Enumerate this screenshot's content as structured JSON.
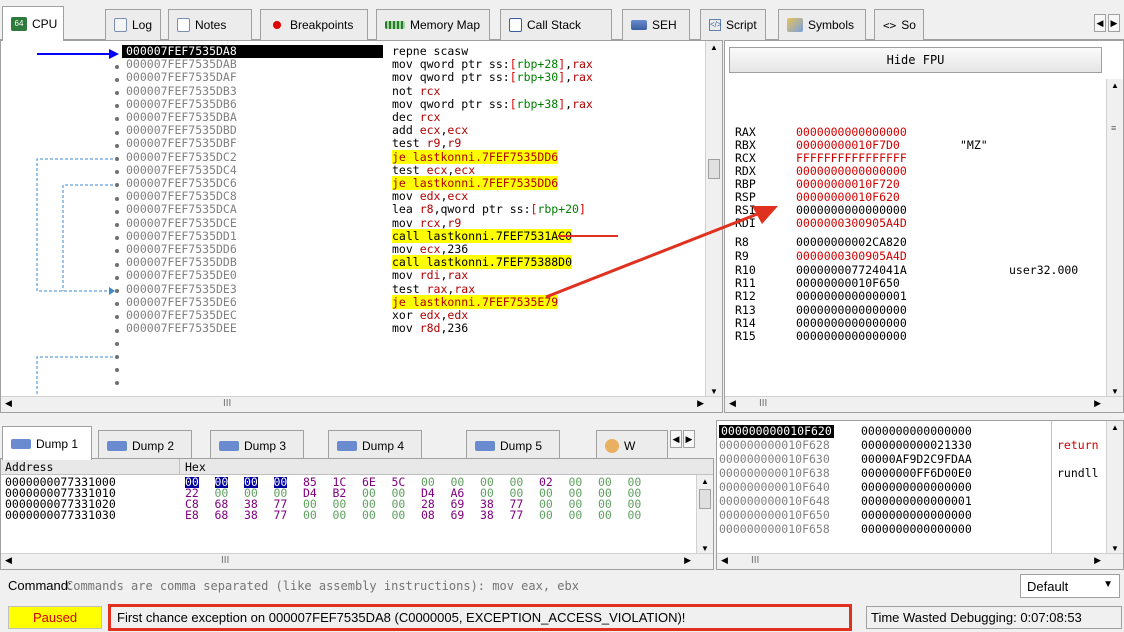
{
  "tabs": [
    {
      "label": "CPU",
      "icon": "cpu-icon"
    },
    {
      "label": "Log",
      "icon": "log-icon"
    },
    {
      "label": "Notes",
      "icon": "notes-icon"
    },
    {
      "label": "Breakpoints",
      "icon": "breakpoint-icon"
    },
    {
      "label": "Memory Map",
      "icon": "memory-map-icon"
    },
    {
      "label": "Call Stack",
      "icon": "call-stack-icon"
    },
    {
      "label": "SEH",
      "icon": "seh-icon"
    },
    {
      "label": "Script",
      "icon": "script-icon"
    },
    {
      "label": "Symbols",
      "icon": "symbols-icon"
    },
    {
      "label": "So",
      "icon": "source-icon"
    }
  ],
  "disasm": {
    "rip_label": "RIP",
    "rows": [
      {
        "addr": "000007FEF7535DA8",
        "ins": "repne scasw"
      },
      {
        "addr": "000007FEF7535DAB",
        "ins": "mov qword ptr ss:[rbp+28],rax"
      },
      {
        "addr": "000007FEF7535DAF",
        "ins": "mov qword ptr ss:[rbp+30],rax"
      },
      {
        "addr": "000007FEF7535DB3",
        "ins": "not rcx"
      },
      {
        "addr": "000007FEF7535DB6",
        "ins": "mov qword ptr ss:[rbp+38],rax"
      },
      {
        "addr": "000007FEF7535DBA",
        "ins": "dec rcx"
      },
      {
        "addr": "000007FEF7535DBD",
        "ins": "add ecx,ecx"
      },
      {
        "addr": "000007FEF7535DBF",
        "ins": "test r9,r9"
      },
      {
        "addr": "000007FEF7535DC2",
        "ins": "je lastkonni.7FEF7535DD6"
      },
      {
        "addr": "000007FEF7535DC4",
        "ins": "test ecx,ecx"
      },
      {
        "addr": "000007FEF7535DC6",
        "ins": "je lastkonni.7FEF7535DD6"
      },
      {
        "addr": "000007FEF7535DC8",
        "ins": "mov edx,ecx"
      },
      {
        "addr": "000007FEF7535DCA",
        "ins": "lea r8,qword ptr ss:[rbp+20]"
      },
      {
        "addr": "000007FEF7535DCE",
        "ins": "mov rcx,r9"
      },
      {
        "addr": "000007FEF7535DD1",
        "ins": "call lastkonni.7FEF7531AC0"
      },
      {
        "addr": "000007FEF7535DD6",
        "ins": "mov ecx,236"
      },
      {
        "addr": "000007FEF7535DDB",
        "ins": "call lastkonni.7FEF75388D0"
      },
      {
        "addr": "000007FEF7535DE0",
        "ins": "mov rdi,rax"
      },
      {
        "addr": "000007FEF7535DE3",
        "ins": "test rax,rax"
      },
      {
        "addr": "000007FEF7535DE6",
        "ins": "je lastkonni.7FEF7535E79"
      },
      {
        "addr": "000007FEF7535DEC",
        "ins": "xor edx,edx"
      },
      {
        "addr": "000007FEF7535DEE",
        "ins": "mov r8d,236"
      }
    ],
    "hscroll_grip": "III"
  },
  "fpu": {
    "hide_label": "Hide FPU",
    "registers": [
      {
        "name": "RAX",
        "value": "0000000000000000",
        "comment": "",
        "color": "#d00000"
      },
      {
        "name": "RBX",
        "value": "00000000010F7D0",
        "comment": "\"MZ\"",
        "color": "#d00000"
      },
      {
        "name": "RCX",
        "value": "FFFFFFFFFFFFFFFF",
        "comment": "",
        "color": "#d00000"
      },
      {
        "name": "RDX",
        "value": "0000000000000000",
        "comment": "",
        "color": "#d00000"
      },
      {
        "name": "RBP",
        "value": "00000000010F720",
        "comment": "",
        "color": "#d00000"
      },
      {
        "name": "RSP",
        "value": "00000000010F620",
        "comment": "",
        "color": "#d00000"
      },
      {
        "name": "RSI",
        "value": "0000000000000000",
        "comment": "",
        "color": "#000000"
      },
      {
        "name": "RDI",
        "value": "0000000300905A4D",
        "comment": "",
        "color": "#d00000"
      },
      {
        "name": "R8",
        "value": "00000000002CA820",
        "comment": "",
        "color": "#000000"
      },
      {
        "name": "R9",
        "value": "0000000300905A4D",
        "comment": "",
        "color": "#d00000"
      },
      {
        "name": "R10",
        "value": "000000007724041A",
        "comment": "user32.000",
        "color": "#000000"
      },
      {
        "name": "R11",
        "value": "00000000010F650",
        "comment": "",
        "color": "#000000"
      },
      {
        "name": "R12",
        "value": "0000000000000001",
        "comment": "",
        "color": "#000000"
      },
      {
        "name": "R13",
        "value": "0000000000000000",
        "comment": "",
        "color": "#000000"
      },
      {
        "name": "R14",
        "value": "0000000000000000",
        "comment": "",
        "color": "#000000"
      },
      {
        "name": "R15",
        "value": "0000000000000000",
        "comment": "",
        "color": "#000000"
      }
    ],
    "hscroll_grip": "III"
  },
  "dump": {
    "tabs": [
      "Dump 1",
      "Dump 2",
      "Dump 3",
      "Dump 4",
      "Dump 5",
      "W"
    ],
    "col_address": "Address",
    "col_hex": "Hex",
    "rows": [
      {
        "addr": "0000000077331000",
        "bytes": [
          "00",
          "00",
          "00",
          "00",
          "85",
          "1C",
          "6E",
          "5C",
          "00",
          "00",
          "00",
          "00",
          "02",
          "00",
          "00",
          "00"
        ]
      },
      {
        "addr": "0000000077331010",
        "bytes": [
          "22",
          "00",
          "00",
          "00",
          "D4",
          "B2",
          "00",
          "00",
          "D4",
          "A6",
          "00",
          "00",
          "00",
          "00",
          "00",
          "00"
        ]
      },
      {
        "addr": "0000000077331020",
        "bytes": [
          "C8",
          "68",
          "38",
          "77",
          "00",
          "00",
          "00",
          "00",
          "28",
          "69",
          "38",
          "77",
          "00",
          "00",
          "00",
          "00"
        ]
      },
      {
        "addr": "0000000077331030",
        "bytes": [
          "E8",
          "68",
          "38",
          "77",
          "00",
          "00",
          "00",
          "00",
          "08",
          "69",
          "38",
          "77",
          "00",
          "00",
          "00",
          "00"
        ]
      }
    ],
    "hscroll_grip": "III"
  },
  "stack": {
    "rows": [
      {
        "addr": "000000000010F620",
        "value": "0000000000000000",
        "comment": ""
      },
      {
        "addr": "000000000010F628",
        "value": "0000000000021330",
        "comment": "return"
      },
      {
        "addr": "000000000010F630",
        "value": "00000AF9D2C9FDAA",
        "comment": ""
      },
      {
        "addr": "000000000010F638",
        "value": "00000000FF6D00E0",
        "comment": "rundll"
      },
      {
        "addr": "000000000010F640",
        "value": "0000000000000000",
        "comment": ""
      },
      {
        "addr": "000000000010F648",
        "value": "0000000000000001",
        "comment": ""
      },
      {
        "addr": "000000000010F650",
        "value": "0000000000000000",
        "comment": ""
      },
      {
        "addr": "000000000010F658",
        "value": "0000000000000000",
        "comment": ""
      }
    ],
    "hscroll_grip": "III"
  },
  "command": {
    "label": "Command:",
    "placeholder": "Commands are comma separated (like assembly instructions): mov eax, ebx",
    "mode": "Default"
  },
  "status": {
    "state": "Paused",
    "message": "First chance exception on 000007FEF7535DA8 (C0000005, EXCEPTION_ACCESS_VIOLATION)!",
    "time": "Time Wasted Debugging: 0:07:08:53"
  },
  "colors": {
    "accent_red": "#e0301e",
    "highlight_yellow": "#ffff00",
    "paused_bg": "#ffff00"
  }
}
